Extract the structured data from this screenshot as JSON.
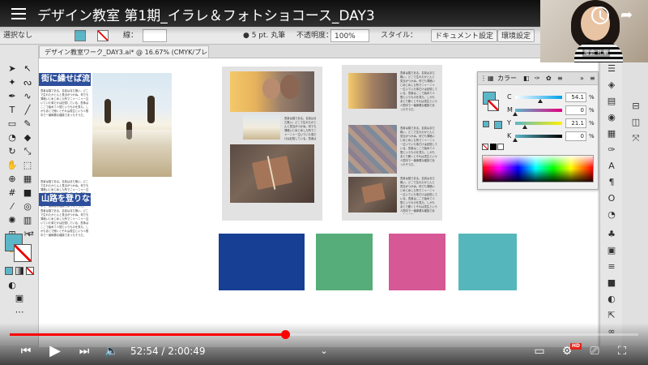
{
  "video": {
    "title": "デザイン教室 第1期_イラレ＆フォトショコース_DAY3",
    "current_time": "52:54",
    "duration": "2:00:49",
    "time_separator": " / ",
    "progress_percent": 43.8,
    "quality_badge": "HD"
  },
  "webcam": {
    "presenter_name": "藤倉 礼華"
  },
  "control_bar": {
    "left_label": "選択なし",
    "stroke_label": "線：",
    "stroke_size": "5 pt. 丸筆",
    "opacity_label": "不透明度：",
    "opacity_value": "100%",
    "style_label": "スタイル：",
    "document_settings_button": "ドキュメント設定",
    "preferences_button": "環境設定",
    "fill_color": "#5bb7c8"
  },
  "document_tab": {
    "label": "デザイン教室ワーク_DAY3.ai* @ 16.67% (CMYK/プレビュー)"
  },
  "layout_left": {
    "heading_1": "街に繰せば流さ",
    "heading_2": "山路を登りながら"
  },
  "color_panel": {
    "tab_label": "カラー",
    "sliders": [
      {
        "channel": "C",
        "value": "54.1",
        "unit": "%",
        "level": 54.1,
        "gradient": "linear-gradient(to right,#ffffff,#00a0e9)"
      },
      {
        "channel": "M",
        "value": "0",
        "unit": "%",
        "level": 0,
        "gradient": "linear-gradient(to right,#5bb7c8,#e4007f)"
      },
      {
        "channel": "Y",
        "value": "21.1",
        "unit": "%",
        "level": 21.1,
        "gradient": "linear-gradient(to right,#5bb7c8,#fff100)"
      },
      {
        "channel": "K",
        "value": "0",
        "unit": "%",
        "level": 0,
        "gradient": "linear-gradient(to right,#5bb7c8,#000000)"
      }
    ]
  },
  "color_tiles": [
    {
      "name": "navy-tile",
      "color": "#173f93"
    },
    {
      "name": "green-tile",
      "color": "#56ad79"
    },
    {
      "name": "pink-tile",
      "color": "#d65895"
    },
    {
      "name": "teal-tile",
      "color": "#55b7bc"
    }
  ],
  "body_text": "吾輩は猫である。名前はまだ無い。どこで生れたかとんと見当がつかぬ。何でも薄暗いじめじめした所でニャーニャー泣いていた事だけは記憶している。吾輩はここで始めて人間というものを見た。しかもあとで聞くとそれは書生という人間中で一番獰悪な種族であったそうだ。"
}
